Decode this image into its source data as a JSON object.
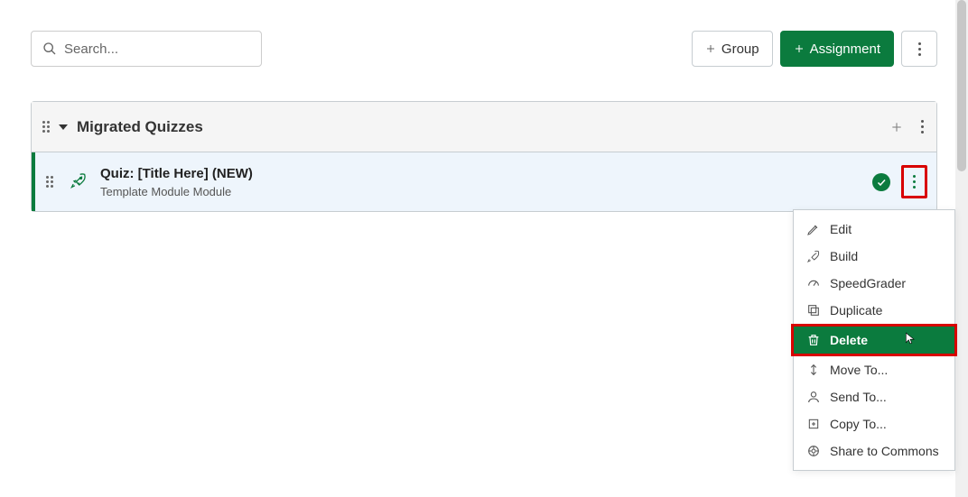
{
  "search": {
    "placeholder": "Search..."
  },
  "buttons": {
    "group": "Group",
    "assignment": "Assignment"
  },
  "group": {
    "title": "Migrated Quizzes"
  },
  "item": {
    "title": "Quiz: [Title Here] (NEW)",
    "subtitle": "Template Module Module"
  },
  "menu": {
    "edit": "Edit",
    "build": "Build",
    "speedgrader": "SpeedGrader",
    "duplicate": "Duplicate",
    "delete": "Delete",
    "move_to": "Move To...",
    "send_to": "Send To...",
    "copy_to": "Copy To...",
    "share_commons": "Share to Commons"
  }
}
